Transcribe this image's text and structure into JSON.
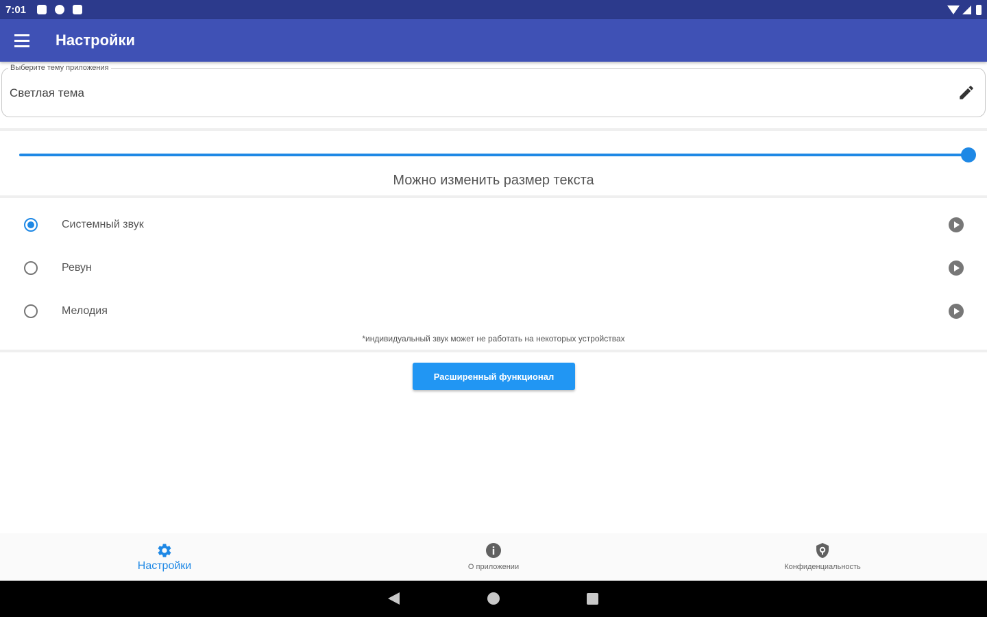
{
  "status_bar": {
    "time": "7:01"
  },
  "app_bar": {
    "title": "Настройки"
  },
  "theme": {
    "label": "Выберите тему приложения",
    "value": "Светлая тема"
  },
  "text_size": {
    "label": "Можно изменить размер текста",
    "level": 1.0
  },
  "sounds": {
    "options": [
      {
        "label": "Системный звук",
        "selected": true
      },
      {
        "label": "Ревун",
        "selected": false
      },
      {
        "label": "Мелодия",
        "selected": false
      }
    ],
    "note": "*индивидуальный звук может не работать на некоторых устройствах"
  },
  "advanced_button": {
    "label": "Расширенный функционал"
  },
  "bottom_nav": {
    "items": [
      {
        "label": "Настройки",
        "icon": "gear-icon",
        "active": true
      },
      {
        "label": "О приложении",
        "icon": "info-icon",
        "active": false
      },
      {
        "label": "Конфиденциальность",
        "icon": "privacy-shield-icon",
        "active": false
      }
    ]
  },
  "colors": {
    "primary": "#3f51b5",
    "primary_dark": "#2c3a8c",
    "accent": "#1e88e5",
    "button": "#2196f3"
  }
}
